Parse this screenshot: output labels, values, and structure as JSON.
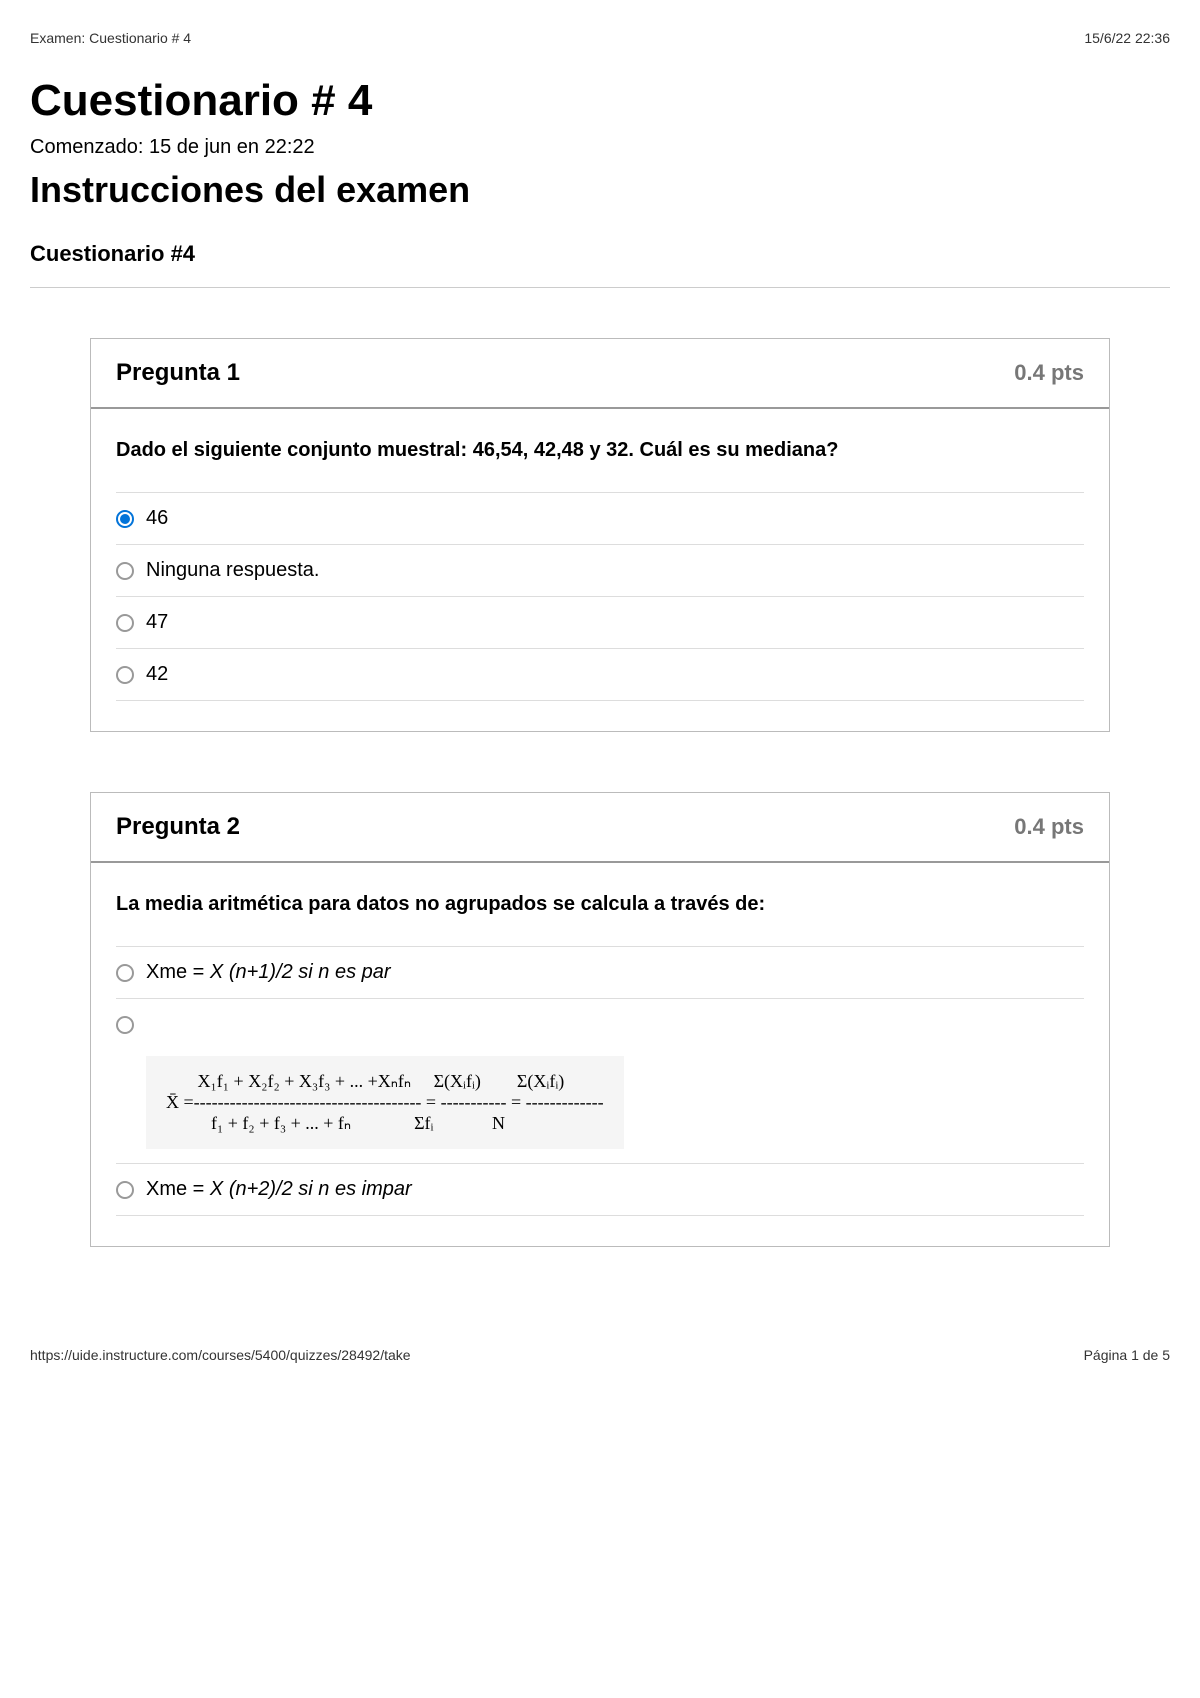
{
  "header": {
    "doc_title": "Examen: Cuestionario # 4",
    "timestamp": "15/6/22 22:36"
  },
  "title": "Cuestionario # 4",
  "started": "Comenzado: 15 de jun en 22:22",
  "instructions_heading": "Instrucciones del examen",
  "subheading": "Cuestionario #4",
  "questions": [
    {
      "title": "Pregunta 1",
      "points": "0.4 pts",
      "prompt": "Dado el siguiente conjunto muestral:   46,54, 42,48 y 32.  Cuál es su mediana?",
      "options": [
        {
          "label": "46",
          "selected": true
        },
        {
          "label": "Ninguna respuesta.",
          "selected": false
        },
        {
          "label": "47",
          "selected": false
        },
        {
          "label": "42",
          "selected": false
        }
      ]
    },
    {
      "title": "Pregunta 2",
      "points": "0.4 pts",
      "prompt": "La media aritmética para datos no agrupados se calcula a través de:",
      "options": [
        {
          "label_html": "Xme = <em>X (n+1)/2 si n es par</em>",
          "selected": false
        },
        {
          "label_html": "",
          "formula": "       X₁f₁ + X₂f₂ + X₃f₃ + ... +Xₙfₙ     Σ(Xᵢfᵢ)        Σ(Xᵢfᵢ)\nX̄ =-------------------------------------- = ----------- = -------------\n          f₁ + f₂ + f₃ + ... + fₙ              Σfᵢ             N",
          "selected": false
        },
        {
          "label_html": "Xme = <em>X (n+2)/2 si n es impar</em>",
          "selected": false
        }
      ]
    }
  ],
  "footer": {
    "url": "https://uide.instructure.com/courses/5400/quizzes/28492/take",
    "page": "Página 1 de 5"
  }
}
